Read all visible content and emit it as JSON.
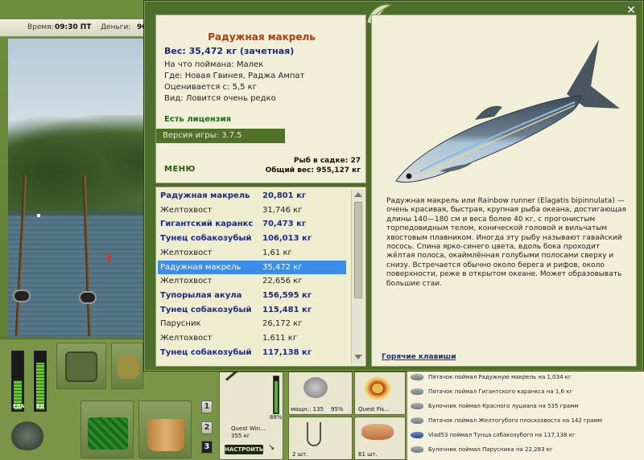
{
  "topbar": {
    "time_label": "Время:",
    "time_value": "09:30 ПТ",
    "money_label": "Деньги:",
    "money_value": "90"
  },
  "fish_card": {
    "name": "Радужная макрель",
    "weight": "Вес: 35,472 кг (зачетная)",
    "caught_on": "На что поймана: Малек",
    "where": "Где: Новая Гвинея, Раджа Ампат",
    "valued_from": "Оценивается с: 5,5 кг",
    "kind": "Вид: Ловится очень редко",
    "license": "Есть лицензия",
    "version": "Версия игры: 3.7.5",
    "fish_in_keepnet": "Рыб в садке: 27",
    "total_weight": "Общий вес: 955,127 кг",
    "menu_label": "МЕНЮ"
  },
  "fish_list": [
    {
      "name": "Радужная макрель",
      "weight": "20,801 кг",
      "style": "bold"
    },
    {
      "name": "Желтохвост",
      "weight": "31,746 кг",
      "style": "plain"
    },
    {
      "name": "Гигантский каранкс",
      "weight": "70,473 кг",
      "style": "bold"
    },
    {
      "name": "Тунец собакозубый",
      "weight": "106,013 кг",
      "style": "bold"
    },
    {
      "name": "Желтохвост",
      "weight": "1,61 кг",
      "style": "plain"
    },
    {
      "name": "Радужная макрель",
      "weight": "35,472 кг",
      "style": "selected"
    },
    {
      "name": "Желтохвост",
      "weight": "22,656 кг",
      "style": "plain"
    },
    {
      "name": "Тупорылая акула",
      "weight": "156,595 кг",
      "style": "bold"
    },
    {
      "name": "Тунец собакозубый",
      "weight": "115,481 кг",
      "style": "bold"
    },
    {
      "name": "Парусник",
      "weight": "26,172 кг",
      "style": "plain"
    },
    {
      "name": "Желтохвост",
      "weight": "1,611 кг",
      "style": "plain"
    },
    {
      "name": "Тунец собакозубый",
      "weight": "117,138 кг",
      "style": "bold"
    }
  ],
  "description": "Радужная макрель или Rainbow runner (Elagatis bipinnulata) — очень красивая, быстрая, крупная рыба океана, достигающая длины 140—180 см и веса более 40 кг, с прогонистым торпедовидным телом, конической головой и вильчатым хвостовым плавником. Иногда эту рыбу называют гавайский лосось. Спина ярко-синего цвета, вдоль бока проходит жёлтая полоса, окаймлённая голубыми полосами сверху и снизу. Встречается обычно около берега и рифов, около поверхности, реже в открытом океане. Может образовывать большие стаи.",
  "hotkeys_label": "Горячие клавиши",
  "bottom": {
    "food_label": "ЕДА",
    "energy_label": "ВД",
    "food_level": 0.5,
    "energy_level": 0.8,
    "slot_buttons": [
      "1",
      "2",
      "3"
    ],
    "rod_name": "Quest Win...",
    "rod_weight": "355 кг",
    "rod_percent": "88%",
    "setup_label": "НАСТРОИТЬ",
    "reel_label": "мощн.: 135",
    "reel_percent": "95%",
    "line_label": "Quest Fis...",
    "hooks_count": "2 шт.",
    "bait_count": "61 шт."
  },
  "catch_log": [
    {
      "text": "Пятачок поймал Радужную макрель на 1,034 кг",
      "icon": "fish-icon"
    },
    {
      "text": "Пятачок поймал Гигантского каранкса на 1,6 кг",
      "icon": "fish-icon"
    },
    {
      "text": "Булочник поймал Красного луциана на 535 грамм",
      "icon": "fish-icon"
    },
    {
      "text": "Пятачок поймал Желтогубого плоскохвоста на 142 грамм",
      "icon": "fish-icon"
    },
    {
      "text": "Vlad53 поймал Тунца собакозубого на 117,138 кг",
      "icon": "blue-fish-icon"
    },
    {
      "text": "Булочник поймал Парусника на 22,283 кг",
      "icon": "fish-icon"
    }
  ],
  "colors": {
    "frame_green": "#4d6f2c",
    "panel_cream": "#f1efd8",
    "title_orange": "#b73a10",
    "selected_blue": "#3a8ee8",
    "bold_row_blue": "#1c2a84"
  }
}
